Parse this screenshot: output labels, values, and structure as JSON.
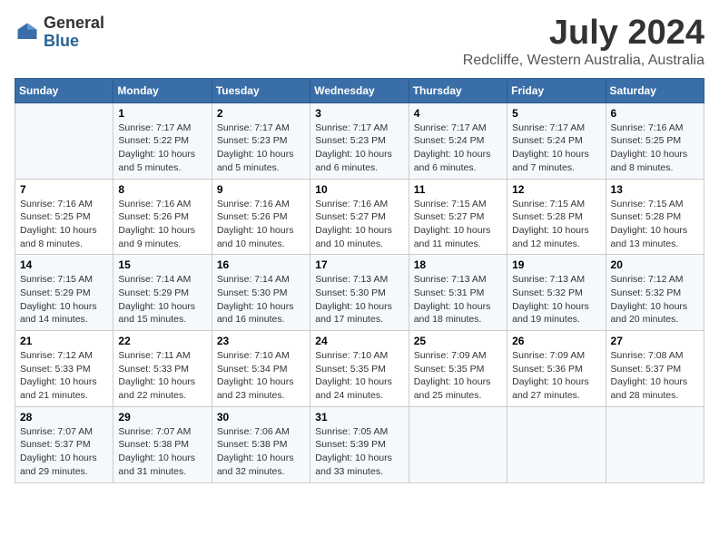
{
  "header": {
    "logo_general": "General",
    "logo_blue": "Blue",
    "month": "July 2024",
    "location": "Redcliffe, Western Australia, Australia"
  },
  "weekdays": [
    "Sunday",
    "Monday",
    "Tuesday",
    "Wednesday",
    "Thursday",
    "Friday",
    "Saturday"
  ],
  "weeks": [
    [
      {
        "day": "",
        "sunrise": "",
        "sunset": "",
        "daylight": ""
      },
      {
        "day": "1",
        "sunrise": "Sunrise: 7:17 AM",
        "sunset": "Sunset: 5:22 PM",
        "daylight": "Daylight: 10 hours and 5 minutes."
      },
      {
        "day": "2",
        "sunrise": "Sunrise: 7:17 AM",
        "sunset": "Sunset: 5:23 PM",
        "daylight": "Daylight: 10 hours and 5 minutes."
      },
      {
        "day": "3",
        "sunrise": "Sunrise: 7:17 AM",
        "sunset": "Sunset: 5:23 PM",
        "daylight": "Daylight: 10 hours and 6 minutes."
      },
      {
        "day": "4",
        "sunrise": "Sunrise: 7:17 AM",
        "sunset": "Sunset: 5:24 PM",
        "daylight": "Daylight: 10 hours and 6 minutes."
      },
      {
        "day": "5",
        "sunrise": "Sunrise: 7:17 AM",
        "sunset": "Sunset: 5:24 PM",
        "daylight": "Daylight: 10 hours and 7 minutes."
      },
      {
        "day": "6",
        "sunrise": "Sunrise: 7:16 AM",
        "sunset": "Sunset: 5:25 PM",
        "daylight": "Daylight: 10 hours and 8 minutes."
      }
    ],
    [
      {
        "day": "7",
        "sunrise": "Sunrise: 7:16 AM",
        "sunset": "Sunset: 5:25 PM",
        "daylight": "Daylight: 10 hours and 8 minutes."
      },
      {
        "day": "8",
        "sunrise": "Sunrise: 7:16 AM",
        "sunset": "Sunset: 5:26 PM",
        "daylight": "Daylight: 10 hours and 9 minutes."
      },
      {
        "day": "9",
        "sunrise": "Sunrise: 7:16 AM",
        "sunset": "Sunset: 5:26 PM",
        "daylight": "Daylight: 10 hours and 10 minutes."
      },
      {
        "day": "10",
        "sunrise": "Sunrise: 7:16 AM",
        "sunset": "Sunset: 5:27 PM",
        "daylight": "Daylight: 10 hours and 10 minutes."
      },
      {
        "day": "11",
        "sunrise": "Sunrise: 7:15 AM",
        "sunset": "Sunset: 5:27 PM",
        "daylight": "Daylight: 10 hours and 11 minutes."
      },
      {
        "day": "12",
        "sunrise": "Sunrise: 7:15 AM",
        "sunset": "Sunset: 5:28 PM",
        "daylight": "Daylight: 10 hours and 12 minutes."
      },
      {
        "day": "13",
        "sunrise": "Sunrise: 7:15 AM",
        "sunset": "Sunset: 5:28 PM",
        "daylight": "Daylight: 10 hours and 13 minutes."
      }
    ],
    [
      {
        "day": "14",
        "sunrise": "Sunrise: 7:15 AM",
        "sunset": "Sunset: 5:29 PM",
        "daylight": "Daylight: 10 hours and 14 minutes."
      },
      {
        "day": "15",
        "sunrise": "Sunrise: 7:14 AM",
        "sunset": "Sunset: 5:29 PM",
        "daylight": "Daylight: 10 hours and 15 minutes."
      },
      {
        "day": "16",
        "sunrise": "Sunrise: 7:14 AM",
        "sunset": "Sunset: 5:30 PM",
        "daylight": "Daylight: 10 hours and 16 minutes."
      },
      {
        "day": "17",
        "sunrise": "Sunrise: 7:13 AM",
        "sunset": "Sunset: 5:30 PM",
        "daylight": "Daylight: 10 hours and 17 minutes."
      },
      {
        "day": "18",
        "sunrise": "Sunrise: 7:13 AM",
        "sunset": "Sunset: 5:31 PM",
        "daylight": "Daylight: 10 hours and 18 minutes."
      },
      {
        "day": "19",
        "sunrise": "Sunrise: 7:13 AM",
        "sunset": "Sunset: 5:32 PM",
        "daylight": "Daylight: 10 hours and 19 minutes."
      },
      {
        "day": "20",
        "sunrise": "Sunrise: 7:12 AM",
        "sunset": "Sunset: 5:32 PM",
        "daylight": "Daylight: 10 hours and 20 minutes."
      }
    ],
    [
      {
        "day": "21",
        "sunrise": "Sunrise: 7:12 AM",
        "sunset": "Sunset: 5:33 PM",
        "daylight": "Daylight: 10 hours and 21 minutes."
      },
      {
        "day": "22",
        "sunrise": "Sunrise: 7:11 AM",
        "sunset": "Sunset: 5:33 PM",
        "daylight": "Daylight: 10 hours and 22 minutes."
      },
      {
        "day": "23",
        "sunrise": "Sunrise: 7:10 AM",
        "sunset": "Sunset: 5:34 PM",
        "daylight": "Daylight: 10 hours and 23 minutes."
      },
      {
        "day": "24",
        "sunrise": "Sunrise: 7:10 AM",
        "sunset": "Sunset: 5:35 PM",
        "daylight": "Daylight: 10 hours and 24 minutes."
      },
      {
        "day": "25",
        "sunrise": "Sunrise: 7:09 AM",
        "sunset": "Sunset: 5:35 PM",
        "daylight": "Daylight: 10 hours and 25 minutes."
      },
      {
        "day": "26",
        "sunrise": "Sunrise: 7:09 AM",
        "sunset": "Sunset: 5:36 PM",
        "daylight": "Daylight: 10 hours and 27 minutes."
      },
      {
        "day": "27",
        "sunrise": "Sunrise: 7:08 AM",
        "sunset": "Sunset: 5:37 PM",
        "daylight": "Daylight: 10 hours and 28 minutes."
      }
    ],
    [
      {
        "day": "28",
        "sunrise": "Sunrise: 7:07 AM",
        "sunset": "Sunset: 5:37 PM",
        "daylight": "Daylight: 10 hours and 29 minutes."
      },
      {
        "day": "29",
        "sunrise": "Sunrise: 7:07 AM",
        "sunset": "Sunset: 5:38 PM",
        "daylight": "Daylight: 10 hours and 31 minutes."
      },
      {
        "day": "30",
        "sunrise": "Sunrise: 7:06 AM",
        "sunset": "Sunset: 5:38 PM",
        "daylight": "Daylight: 10 hours and 32 minutes."
      },
      {
        "day": "31",
        "sunrise": "Sunrise: 7:05 AM",
        "sunset": "Sunset: 5:39 PM",
        "daylight": "Daylight: 10 hours and 33 minutes."
      },
      {
        "day": "",
        "sunrise": "",
        "sunset": "",
        "daylight": ""
      },
      {
        "day": "",
        "sunrise": "",
        "sunset": "",
        "daylight": ""
      },
      {
        "day": "",
        "sunrise": "",
        "sunset": "",
        "daylight": ""
      }
    ]
  ]
}
